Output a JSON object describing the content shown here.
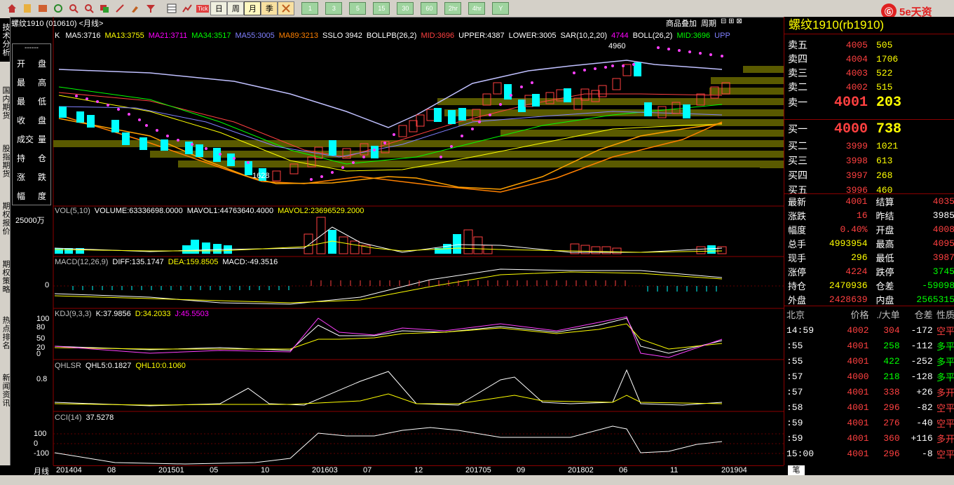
{
  "toolbar": {
    "periods": [
      "日",
      "周",
      "月",
      "季",
      "年"
    ],
    "active_period": "月",
    "green_buttons": [
      "1",
      "3",
      "5",
      "15",
      "30",
      "60",
      "2hr",
      "4hr",
      "Y"
    ],
    "tick_label": "Tick"
  },
  "brand": {
    "logo": "Ⓖ",
    "name": "5e天资",
    "sub": ""
  },
  "left_tabs": [
    "技术分析",
    "国内期货",
    "股指期货",
    "期权报价",
    "期权策略",
    "热点排名",
    "新闻资讯"
  ],
  "chart": {
    "title": "螺纹1910 (010610) <月线>",
    "tools": [
      "商品叠加",
      "周期"
    ],
    "ma_line": {
      "k": "K",
      "items": [
        {
          "text": "MA5:3716",
          "color": "#ffffff"
        },
        {
          "text": "MA13:3755",
          "color": "#ffff00"
        },
        {
          "text": "MA21:3711",
          "color": "#ff00ff"
        },
        {
          "text": "MA34:3517",
          "color": "#00ff00"
        },
        {
          "text": "MA55:3005",
          "color": "#8080ff"
        },
        {
          "text": "MA89:3213",
          "color": "#ff8000"
        },
        {
          "text": "SSLO 3942",
          "color": "#ffffff"
        },
        {
          "text": "BOLLPB(26,2)",
          "color": "#ffffff"
        },
        {
          "text": "MID:3696",
          "color": "#ff4040"
        },
        {
          "text": "UPPER:4387",
          "color": "#ffffff"
        },
        {
          "text": "LOWER:3005",
          "color": "#ffffff"
        },
        {
          "text": "SAR(10,2,20)",
          "color": "#ffffff"
        },
        {
          "text": "4744",
          "color": "#ff00ff"
        },
        {
          "text": "BOLL(26,2)",
          "color": "#ffffff"
        },
        {
          "text": "MID:3696",
          "color": "#00ff00"
        },
        {
          "text": "UPP",
          "color": "#8080ff"
        }
      ]
    },
    "high_label": "4960",
    "low_label": "1628",
    "popup": {
      "dash": "------",
      "rows": [
        [
          "开",
          "盘"
        ],
        [
          "最",
          "高"
        ],
        [
          "最",
          "低"
        ],
        [
          "收",
          "盘"
        ],
        [
          "成交",
          "量"
        ],
        [
          "持",
          "仓"
        ],
        [
          "涨",
          "跌"
        ],
        [
          "幅",
          "度"
        ]
      ]
    },
    "vol": {
      "header": [
        {
          "text": "VOL(5,10)",
          "color": "#c0c0c0"
        },
        {
          "text": "VOLUME:63336698.0000",
          "color": "#ffffff"
        },
        {
          "text": "MAVOL1:44763640.4000",
          "color": "#ffffff"
        },
        {
          "text": "MAVOL2:23696529.2000",
          "color": "#ffff00"
        }
      ],
      "axis": "25000万"
    },
    "macd": {
      "header": [
        {
          "text": "MACD(12,26,9)",
          "color": "#c0c0c0"
        },
        {
          "text": "DIFF:135.1747",
          "color": "#ffffff"
        },
        {
          "text": "DEA:159.8505",
          "color": "#ffff00"
        },
        {
          "text": "MACD:-49.3516",
          "color": "#ffffff"
        }
      ],
      "axis": "0"
    },
    "kdj": {
      "header": [
        {
          "text": "KDJ(9,3,3)",
          "color": "#c0c0c0"
        },
        {
          "text": "K:37.9856",
          "color": "#ffffff"
        },
        {
          "text": "D:34.2033",
          "color": "#ffff00"
        },
        {
          "text": "J:45.5503",
          "color": "#ff00ff"
        }
      ],
      "axis": [
        "100",
        "80",
        "50",
        "20",
        "0"
      ]
    },
    "qhlsr": {
      "header": [
        {
          "text": "QHLSR",
          "color": "#c0c0c0"
        },
        {
          "text": "QHL5:0.1827",
          "color": "#ffffff"
        },
        {
          "text": "QHL10:0.1060",
          "color": "#ffff00"
        }
      ],
      "axis": "0.8"
    },
    "cci": {
      "header": [
        {
          "text": "CCI(14)",
          "color": "#c0c0c0"
        },
        {
          "text": "37.5278",
          "color": "#ffffff"
        }
      ],
      "axis": [
        "100",
        "0",
        "-100"
      ]
    },
    "xaxis_yl": "月线",
    "xaxis": [
      "201404",
      "08",
      "201501",
      "05",
      "10",
      "201603",
      "07",
      "12",
      "201705",
      "09",
      "201802",
      "06",
      "11",
      "201904"
    ]
  },
  "panel": {
    "title": "螺纹1910(rb1910)",
    "asks": [
      {
        "label": "卖五",
        "price": "4005",
        "vol": "505"
      },
      {
        "label": "卖四",
        "price": "4004",
        "vol": "1706"
      },
      {
        "label": "卖三",
        "price": "4003",
        "vol": "522"
      },
      {
        "label": "卖二",
        "price": "4002",
        "vol": "515"
      },
      {
        "label": "卖一",
        "price": "4001",
        "vol": "203"
      }
    ],
    "bids": [
      {
        "label": "买一",
        "price": "4000",
        "vol": "738"
      },
      {
        "label": "买二",
        "price": "3999",
        "vol": "1021"
      },
      {
        "label": "买三",
        "price": "3998",
        "vol": "613"
      },
      {
        "label": "买四",
        "price": "3997",
        "vol": "268"
      },
      {
        "label": "买五",
        "price": "3996",
        "vol": "460"
      }
    ],
    "stats": [
      {
        "l": "最新",
        "v": "4001",
        "vc": "#ff4040",
        "l2": "结算",
        "v2": "4035",
        "v2c": "#ff4040"
      },
      {
        "l": "涨跌",
        "v": "16",
        "vc": "#ff4040",
        "l2": "昨结",
        "v2": "3985",
        "v2c": "#ffffff"
      },
      {
        "l": "幅度",
        "v": "0.40%",
        "vc": "#ff4040",
        "l2": "开盘",
        "v2": "4008",
        "v2c": "#ff4040"
      },
      {
        "l": "总手",
        "v": "4993954",
        "vc": "#ffff00",
        "l2": "最高",
        "v2": "4095",
        "v2c": "#ff4040"
      },
      {
        "l": "现手",
        "v": "296",
        "vc": "#ffff00",
        "l2": "最低",
        "v2": "3987",
        "v2c": "#ff4040"
      },
      {
        "l": "涨停",
        "v": "4224",
        "vc": "#ff4040",
        "l2": "跌停",
        "v2": "3745",
        "v2c": "#00ff00"
      },
      {
        "l": "持仓",
        "v": "2470936",
        "vc": "#ffff00",
        "l2": "仓差",
        "v2": "-59098",
        "v2c": "#00ff00"
      },
      {
        "l": "外盘",
        "v": "2428639",
        "vc": "#ff4040",
        "l2": "内盘",
        "v2": "2565315",
        "v2c": "#00ff00"
      }
    ],
    "tick_header": [
      "北京",
      "价格",
      "./大单",
      "仓差",
      "性质"
    ],
    "ticks": [
      {
        "t": "14:59",
        "p": "4002",
        "pc": "#ff4040",
        "v": "304",
        "vc": "#ff4040",
        "o": "-172",
        "ty": "空平",
        "tc": "#ff4040"
      },
      {
        "t": ":55",
        "p": "4001",
        "pc": "#ff4040",
        "v": "258",
        "vc": "#00ff00",
        "o": "-112",
        "ty": "多平",
        "tc": "#00ff00"
      },
      {
        "t": ":55",
        "p": "4001",
        "pc": "#ff4040",
        "v": "422",
        "vc": "#00ff00",
        "o": "-252",
        "ty": "多平",
        "tc": "#00ff00"
      },
      {
        "t": ":57",
        "p": "4000",
        "pc": "#ff4040",
        "v": "218",
        "vc": "#00ff00",
        "o": "-128",
        "ty": "多平",
        "tc": "#00ff00"
      },
      {
        "t": ":57",
        "p": "4001",
        "pc": "#ff4040",
        "v": "338",
        "vc": "#ff4040",
        "o": "+26",
        "ty": "多开",
        "tc": "#ff4040"
      },
      {
        "t": ":58",
        "p": "4001",
        "pc": "#ff4040",
        "v": "296",
        "vc": "#ff4040",
        "o": "-82",
        "ty": "空平",
        "tc": "#ff4040"
      },
      {
        "t": ":59",
        "p": "4001",
        "pc": "#ff4040",
        "v": "276",
        "vc": "#ff4040",
        "o": "-40",
        "ty": "空平",
        "tc": "#ff4040"
      },
      {
        "t": ":59",
        "p": "4001",
        "pc": "#ff4040",
        "v": "360",
        "vc": "#ff4040",
        "o": "+116",
        "ty": "多开",
        "tc": "#ff4040"
      },
      {
        "t": "15:00",
        "p": "4001",
        "pc": "#ff4040",
        "v": "296",
        "vc": "#ff4040",
        "o": "-8",
        "ty": "空平",
        "tc": "#ff4040"
      }
    ],
    "bottom_tab": "笔"
  },
  "bottom_bar": ""
}
